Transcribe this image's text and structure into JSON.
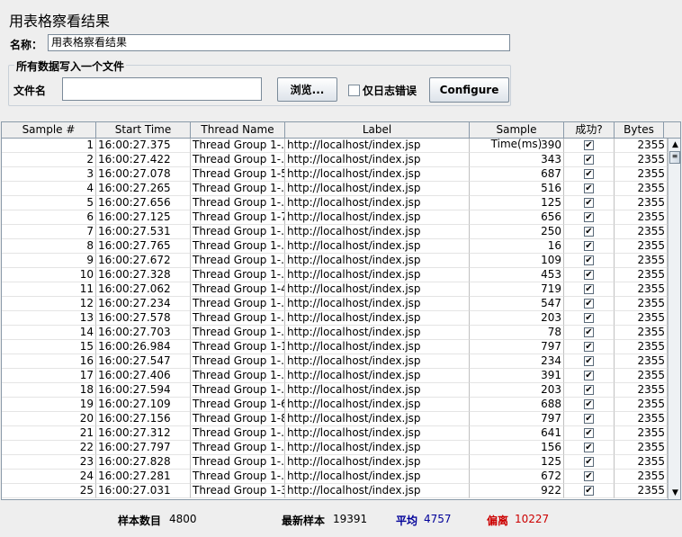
{
  "title": "用表格察看结果",
  "name_label": "名称：",
  "name_value": "用表格察看结果",
  "file_group_legend": "所有数据写入一个文件",
  "file_label": "文件名",
  "file_value": "",
  "browse_label": "浏览...",
  "errors_only_label": "仅日志错误",
  "errors_only_checked": false,
  "configure_label": "Configure",
  "table": {
    "columns": [
      "Sample #",
      "Start Time",
      "Thread Name",
      "Label",
      "Sample Time(ms)",
      "成功?",
      "Bytes"
    ],
    "rows": [
      {
        "n": "1",
        "start": "16:00:27.375",
        "thread": "Thread Group 1-...",
        "label": "http://localhost/index.jsp",
        "ms": "390",
        "ok": true,
        "bytes": "2355"
      },
      {
        "n": "2",
        "start": "16:00:27.422",
        "thread": "Thread Group 1-...",
        "label": "http://localhost/index.jsp",
        "ms": "343",
        "ok": true,
        "bytes": "2355"
      },
      {
        "n": "3",
        "start": "16:00:27.078",
        "thread": "Thread Group 1-5",
        "label": "http://localhost/index.jsp",
        "ms": "687",
        "ok": true,
        "bytes": "2355"
      },
      {
        "n": "4",
        "start": "16:00:27.265",
        "thread": "Thread Group 1-...",
        "label": "http://localhost/index.jsp",
        "ms": "516",
        "ok": true,
        "bytes": "2355"
      },
      {
        "n": "5",
        "start": "16:00:27.656",
        "thread": "Thread Group 1-...",
        "label": "http://localhost/index.jsp",
        "ms": "125",
        "ok": true,
        "bytes": "2355"
      },
      {
        "n": "6",
        "start": "16:00:27.125",
        "thread": "Thread Group 1-7",
        "label": "http://localhost/index.jsp",
        "ms": "656",
        "ok": true,
        "bytes": "2355"
      },
      {
        "n": "7",
        "start": "16:00:27.531",
        "thread": "Thread Group 1-...",
        "label": "http://localhost/index.jsp",
        "ms": "250",
        "ok": true,
        "bytes": "2355"
      },
      {
        "n": "8",
        "start": "16:00:27.765",
        "thread": "Thread Group 1-...",
        "label": "http://localhost/index.jsp",
        "ms": "16",
        "ok": true,
        "bytes": "2355"
      },
      {
        "n": "9",
        "start": "16:00:27.672",
        "thread": "Thread Group 1-...",
        "label": "http://localhost/index.jsp",
        "ms": "109",
        "ok": true,
        "bytes": "2355"
      },
      {
        "n": "10",
        "start": "16:00:27.328",
        "thread": "Thread Group 1-...",
        "label": "http://localhost/index.jsp",
        "ms": "453",
        "ok": true,
        "bytes": "2355"
      },
      {
        "n": "11",
        "start": "16:00:27.062",
        "thread": "Thread Group 1-4",
        "label": "http://localhost/index.jsp",
        "ms": "719",
        "ok": true,
        "bytes": "2355"
      },
      {
        "n": "12",
        "start": "16:00:27.234",
        "thread": "Thread Group 1-...",
        "label": "http://localhost/index.jsp",
        "ms": "547",
        "ok": true,
        "bytes": "2355"
      },
      {
        "n": "13",
        "start": "16:00:27.578",
        "thread": "Thread Group 1-...",
        "label": "http://localhost/index.jsp",
        "ms": "203",
        "ok": true,
        "bytes": "2355"
      },
      {
        "n": "14",
        "start": "16:00:27.703",
        "thread": "Thread Group 1-...",
        "label": "http://localhost/index.jsp",
        "ms": "78",
        "ok": true,
        "bytes": "2355"
      },
      {
        "n": "15",
        "start": "16:00:26.984",
        "thread": "Thread Group 1-1",
        "label": "http://localhost/index.jsp",
        "ms": "797",
        "ok": true,
        "bytes": "2355"
      },
      {
        "n": "16",
        "start": "16:00:27.547",
        "thread": "Thread Group 1-...",
        "label": "http://localhost/index.jsp",
        "ms": "234",
        "ok": true,
        "bytes": "2355"
      },
      {
        "n": "17",
        "start": "16:00:27.406",
        "thread": "Thread Group 1-...",
        "label": "http://localhost/index.jsp",
        "ms": "391",
        "ok": true,
        "bytes": "2355"
      },
      {
        "n": "18",
        "start": "16:00:27.594",
        "thread": "Thread Group 1-...",
        "label": "http://localhost/index.jsp",
        "ms": "203",
        "ok": true,
        "bytes": "2355"
      },
      {
        "n": "19",
        "start": "16:00:27.109",
        "thread": "Thread Group 1-6",
        "label": "http://localhost/index.jsp",
        "ms": "688",
        "ok": true,
        "bytes": "2355"
      },
      {
        "n": "20",
        "start": "16:00:27.156",
        "thread": "Thread Group 1-8",
        "label": "http://localhost/index.jsp",
        "ms": "797",
        "ok": true,
        "bytes": "2355"
      },
      {
        "n": "21",
        "start": "16:00:27.312",
        "thread": "Thread Group 1-...",
        "label": "http://localhost/index.jsp",
        "ms": "641",
        "ok": true,
        "bytes": "2355"
      },
      {
        "n": "22",
        "start": "16:00:27.797",
        "thread": "Thread Group 1-...",
        "label": "http://localhost/index.jsp",
        "ms": "156",
        "ok": true,
        "bytes": "2355"
      },
      {
        "n": "23",
        "start": "16:00:27.828",
        "thread": "Thread Group 1-...",
        "label": "http://localhost/index.jsp",
        "ms": "125",
        "ok": true,
        "bytes": "2355"
      },
      {
        "n": "24",
        "start": "16:00:27.281",
        "thread": "Thread Group 1-...",
        "label": "http://localhost/index.jsp",
        "ms": "672",
        "ok": true,
        "bytes": "2355"
      },
      {
        "n": "25",
        "start": "16:00:27.031",
        "thread": "Thread Group 1-3",
        "label": "http://localhost/index.jsp",
        "ms": "922",
        "ok": true,
        "bytes": "2355"
      }
    ]
  },
  "stats": {
    "samples_label": "样本数目",
    "samples_value": "4800",
    "latest_label": "最新样本",
    "latest_value": "19391",
    "average_label": "平均",
    "average_value": "4757",
    "deviation_label": "偏离",
    "deviation_value": "10227",
    "average_color": "#000099",
    "deviation_color": "#cc0000"
  },
  "icons": {
    "check": "checkbox-checked-icon",
    "scroll_up": "scroll-up-arrow-icon",
    "scroll_down": "scroll-down-arrow-icon"
  }
}
